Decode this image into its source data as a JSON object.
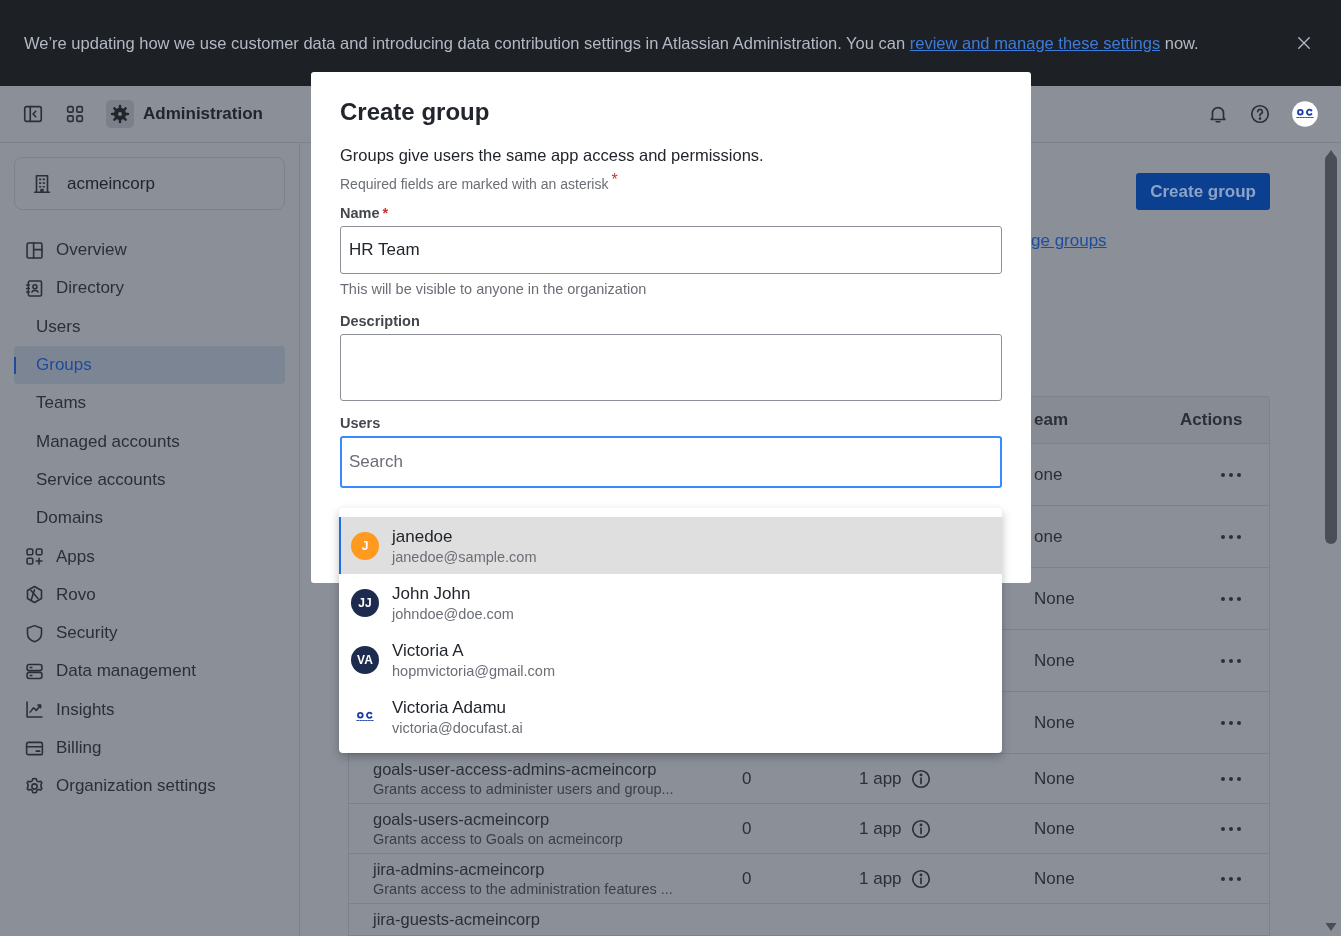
{
  "banner": {
    "text_before": "We’re updating how we use customer data and introducing data contribution settings in Atlassian Administration. You can ",
    "link": "review and manage these settings",
    "text_after": " now."
  },
  "header": {
    "title": "Administration"
  },
  "sidebar": {
    "org": "acmeincorp",
    "items": [
      {
        "label": "Overview",
        "selected": false
      },
      {
        "label": "Directory",
        "selected": false,
        "children": [
          {
            "label": "Users",
            "selected": false
          },
          {
            "label": "Groups",
            "selected": true
          },
          {
            "label": "Teams",
            "selected": false
          },
          {
            "label": "Managed accounts",
            "selected": false
          },
          {
            "label": "Service accounts",
            "selected": false
          },
          {
            "label": "Domains",
            "selected": false
          }
        ]
      },
      {
        "label": "Apps",
        "selected": false
      },
      {
        "label": "Rovo",
        "selected": false
      },
      {
        "label": "Security",
        "selected": false
      },
      {
        "label": "Data management",
        "selected": false
      },
      {
        "label": "Insights",
        "selected": false
      },
      {
        "label": "Billing",
        "selected": false
      },
      {
        "label": "Organization settings",
        "selected": false
      }
    ]
  },
  "page": {
    "primary_button": "Create group",
    "link": "ge groups"
  },
  "table": {
    "header": {
      "team": "eam",
      "actions": "Actions"
    },
    "rows": [
      {
        "team": "one"
      },
      {
        "team": "one"
      },
      {
        "team": "None"
      },
      {
        "team": "None"
      },
      {
        "team": "None"
      },
      {
        "name": "goals-user-access-admins-acmeincorp",
        "description": "Grants access to administer users and group...",
        "members": "0",
        "apps": "1 app",
        "team": "None"
      },
      {
        "name": "goals-users-acmeincorp",
        "description": "Grants access to Goals on acmeincorp",
        "members": "0",
        "apps": "1 app",
        "team": "None"
      },
      {
        "name": "jira-admins-acmeincorp",
        "description": "Grants access to the administration features ...",
        "members": "0",
        "apps": "1 app",
        "team": "None"
      },
      {
        "name": "jira-guests-acmeincorp"
      }
    ]
  },
  "modal": {
    "title": "Create group",
    "description": "Groups give users the same app access and permissions.",
    "required_note": {
      "text": "Required fields are marked with an asterisk",
      "mark": "*"
    },
    "name_field": {
      "label": "Name",
      "required_mark": "*",
      "value": "HR Team",
      "hint": "This will be visible to anyone in the organization"
    },
    "description_field": {
      "label": "Description"
    },
    "users_field": {
      "label": "Users",
      "placeholder": "Search",
      "focused": true
    }
  },
  "users_dropdown": {
    "options": [
      {
        "name": "janedoe",
        "email": "janedoe@sample.com",
        "kind": "initials",
        "initials": "J",
        "color": "#ff991f",
        "selected": true
      },
      {
        "name": "John John",
        "email": "johndoe@doe.com",
        "kind": "initials",
        "initials": "JJ",
        "color": "#1d2b4f",
        "selected": false
      },
      {
        "name": "Victoria A",
        "email": "hopmvictoria@gmail.com",
        "kind": "initials",
        "initials": "VA",
        "color": "#1d2b4f",
        "selected": false
      },
      {
        "name": "Victoria Adamu",
        "email": "victoria@docufast.ai",
        "kind": "image",
        "selected": false
      }
    ]
  }
}
